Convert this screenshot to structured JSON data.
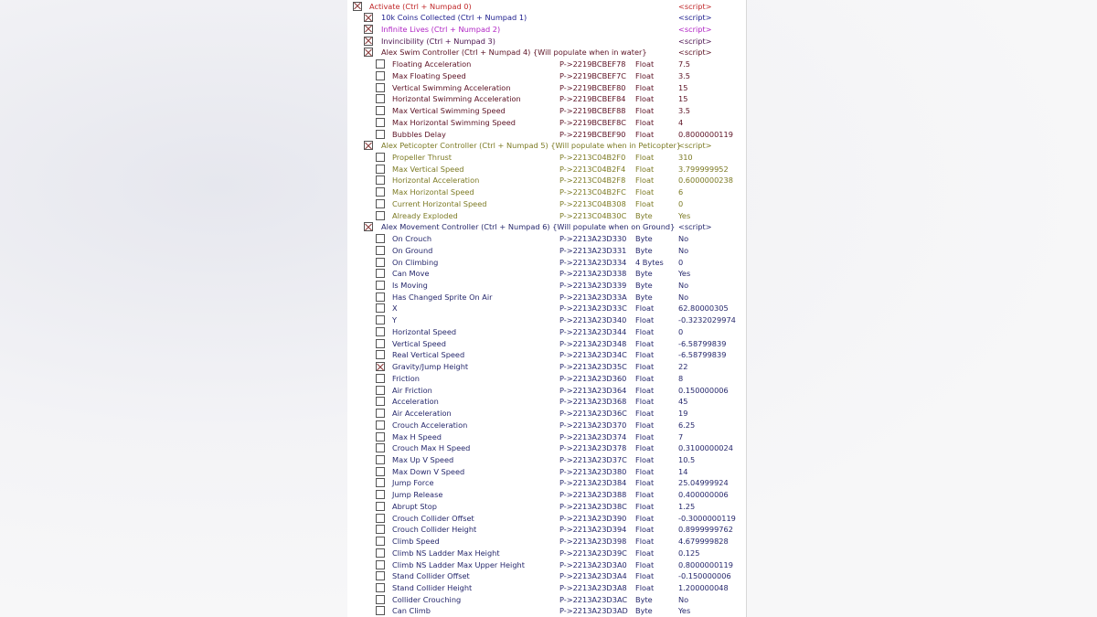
{
  "colors": {
    "activate": "#c0282a",
    "coins": "#1c1c8c",
    "lives": "#b024c4",
    "invincibility": "#4c1450",
    "swim": "#5c1224",
    "peticopter": "#7c7a24",
    "movement": "#26286c"
  },
  "rows": [
    {
      "level": 0,
      "checked": true,
      "label": "Activate (Ctrl + Numpad 0)",
      "value": "<script>",
      "color": "activate"
    },
    {
      "level": 1,
      "checked": true,
      "label": "10k Coins Collected (Ctrl + Numpad 1)",
      "value": "<script>",
      "color": "coins"
    },
    {
      "level": 1,
      "checked": true,
      "label": "Infinite Lives (Ctrl + Numpad 2)",
      "value": "<script>",
      "color": "lives"
    },
    {
      "level": 1,
      "checked": true,
      "label": "Invincibility (Ctrl + Numpad 3)",
      "value": "<script>",
      "color": "invincibility"
    },
    {
      "level": 1,
      "checked": true,
      "label": "Alex Swim Controller (Ctrl + Numpad 4) {Will populate when in water}",
      "value": "<script>",
      "color": "swim"
    },
    {
      "level": 2,
      "checked": false,
      "label": "Floating Acceleration",
      "address": "P->2219BCBEF78",
      "type": "Float",
      "value": "7.5",
      "color": "swim"
    },
    {
      "level": 2,
      "checked": false,
      "label": "Max Floating Speed",
      "address": "P->2219BCBEF7C",
      "type": "Float",
      "value": "3.5",
      "color": "swim"
    },
    {
      "level": 2,
      "checked": false,
      "label": "Vertical Swimming Acceleration",
      "address": "P->2219BCBEF80",
      "type": "Float",
      "value": "15",
      "color": "swim"
    },
    {
      "level": 2,
      "checked": false,
      "label": "Horizontal Swimming Acceleration",
      "address": "P->2219BCBEF84",
      "type": "Float",
      "value": "15",
      "color": "swim"
    },
    {
      "level": 2,
      "checked": false,
      "label": "Max Vertical Swimming Speed",
      "address": "P->2219BCBEF88",
      "type": "Float",
      "value": "3.5",
      "color": "swim"
    },
    {
      "level": 2,
      "checked": false,
      "label": "Max Horizontal Swimming Speed",
      "address": "P->2219BCBEF8C",
      "type": "Float",
      "value": "4",
      "color": "swim"
    },
    {
      "level": 2,
      "checked": false,
      "label": "Bubbles Delay",
      "address": "P->2219BCBEF90",
      "type": "Float",
      "value": "0.8000000119",
      "color": "swim"
    },
    {
      "level": 1,
      "checked": true,
      "label": "Alex Peticopter Controller (Ctrl + Numpad 5) {Will populate when in Peticopter}",
      "value": "<script>",
      "color": "peticopter"
    },
    {
      "level": 2,
      "checked": false,
      "label": "Propeller Thrust",
      "address": "P->2213C04B2F0",
      "type": "Float",
      "value": "310",
      "color": "peticopter"
    },
    {
      "level": 2,
      "checked": false,
      "label": "Max Vertical Speed",
      "address": "P->2213C04B2F4",
      "type": "Float",
      "value": "3.799999952",
      "color": "peticopter"
    },
    {
      "level": 2,
      "checked": false,
      "label": "Horizontal Acceleration",
      "address": "P->2213C04B2F8",
      "type": "Float",
      "value": "0.6000000238",
      "color": "peticopter"
    },
    {
      "level": 2,
      "checked": false,
      "label": "Max Horizontal Speed",
      "address": "P->2213C04B2FC",
      "type": "Float",
      "value": "6",
      "color": "peticopter"
    },
    {
      "level": 2,
      "checked": false,
      "label": "Current Horizontal Speed",
      "address": "P->2213C04B308",
      "type": "Float",
      "value": "0",
      "color": "peticopter"
    },
    {
      "level": 2,
      "checked": false,
      "label": "Already Exploded",
      "address": "P->2213C04B30C",
      "type": "Byte",
      "value": "Yes",
      "color": "peticopter"
    },
    {
      "level": 1,
      "checked": true,
      "label": "Alex Movement Controller (Ctrl + Numpad 6) {Will populate when on Ground}",
      "value": "<script>",
      "color": "movement"
    },
    {
      "level": 2,
      "checked": false,
      "label": "On Crouch",
      "address": "P->2213A23D330",
      "type": "Byte",
      "value": "No",
      "color": "movement"
    },
    {
      "level": 2,
      "checked": false,
      "label": "On Ground",
      "address": "P->2213A23D331",
      "type": "Byte",
      "value": "No",
      "color": "movement"
    },
    {
      "level": 2,
      "checked": false,
      "label": "On Climbing",
      "address": "P->2213A23D334",
      "type": "4 Bytes",
      "value": "0",
      "color": "movement"
    },
    {
      "level": 2,
      "checked": false,
      "label": "Can Move",
      "address": "P->2213A23D338",
      "type": "Byte",
      "value": "Yes",
      "color": "movement"
    },
    {
      "level": 2,
      "checked": false,
      "label": "Is Moving",
      "address": "P->2213A23D339",
      "type": "Byte",
      "value": "No",
      "color": "movement"
    },
    {
      "level": 2,
      "checked": false,
      "label": "Has Changed Sprite On Air",
      "address": "P->2213A23D33A",
      "type": "Byte",
      "value": "No",
      "color": "movement"
    },
    {
      "level": 2,
      "checked": false,
      "label": "X",
      "address": "P->2213A23D33C",
      "type": "Float",
      "value": "62.80000305",
      "color": "movement"
    },
    {
      "level": 2,
      "checked": false,
      "label": "Y",
      "address": "P->2213A23D340",
      "type": "Float",
      "value": "-0.3232029974",
      "color": "movement"
    },
    {
      "level": 2,
      "checked": false,
      "label": "Horizontal Speed",
      "address": "P->2213A23D344",
      "type": "Float",
      "value": "0",
      "color": "movement"
    },
    {
      "level": 2,
      "checked": false,
      "label": "Vertical Speed",
      "address": "P->2213A23D348",
      "type": "Float",
      "value": "-6.58799839",
      "color": "movement"
    },
    {
      "level": 2,
      "checked": false,
      "label": "Real Vertical Speed",
      "address": "P->2213A23D34C",
      "type": "Float",
      "value": "-6.58799839",
      "color": "movement"
    },
    {
      "level": 2,
      "checked": true,
      "label": "Gravity/Jump Height",
      "address": "P->2213A23D35C",
      "type": "Float",
      "value": "22",
      "color": "movement"
    },
    {
      "level": 2,
      "checked": false,
      "label": "Friction",
      "address": "P->2213A23D360",
      "type": "Float",
      "value": "8",
      "color": "movement"
    },
    {
      "level": 2,
      "checked": false,
      "label": "Air Friction",
      "address": "P->2213A23D364",
      "type": "Float",
      "value": "0.150000006",
      "color": "movement"
    },
    {
      "level": 2,
      "checked": false,
      "label": "Acceleration",
      "address": "P->2213A23D368",
      "type": "Float",
      "value": "45",
      "color": "movement"
    },
    {
      "level": 2,
      "checked": false,
      "label": "Air Acceleration",
      "address": "P->2213A23D36C",
      "type": "Float",
      "value": "19",
      "color": "movement"
    },
    {
      "level": 2,
      "checked": false,
      "label": "Crouch Acceleration",
      "address": "P->2213A23D370",
      "type": "Float",
      "value": "6.25",
      "color": "movement"
    },
    {
      "level": 2,
      "checked": false,
      "label": "Max H Speed",
      "address": "P->2213A23D374",
      "type": "Float",
      "value": "7",
      "color": "movement"
    },
    {
      "level": 2,
      "checked": false,
      "label": "Crouch Max H Speed",
      "address": "P->2213A23D378",
      "type": "Float",
      "value": "0.3100000024",
      "color": "movement"
    },
    {
      "level": 2,
      "checked": false,
      "label": "Max Up V Speed",
      "address": "P->2213A23D37C",
      "type": "Float",
      "value": "10.5",
      "color": "movement"
    },
    {
      "level": 2,
      "checked": false,
      "label": "Max Down V Speed",
      "address": "P->2213A23D380",
      "type": "Float",
      "value": "14",
      "color": "movement"
    },
    {
      "level": 2,
      "checked": false,
      "label": "Jump Force",
      "address": "P->2213A23D384",
      "type": "Float",
      "value": "25.04999924",
      "color": "movement"
    },
    {
      "level": 2,
      "checked": false,
      "label": "Jump Release",
      "address": "P->2213A23D388",
      "type": "Float",
      "value": "0.400000006",
      "color": "movement"
    },
    {
      "level": 2,
      "checked": false,
      "label": "Abrupt Stop",
      "address": "P->2213A23D38C",
      "type": "Float",
      "value": "1.25",
      "color": "movement"
    },
    {
      "level": 2,
      "checked": false,
      "label": "Crouch Collider Offset",
      "address": "P->2213A23D390",
      "type": "Float",
      "value": "-0.3000000119",
      "color": "movement"
    },
    {
      "level": 2,
      "checked": false,
      "label": "Crouch Collider Height",
      "address": "P->2213A23D394",
      "type": "Float",
      "value": "0.8999999762",
      "color": "movement"
    },
    {
      "level": 2,
      "checked": false,
      "label": "Climb Speed",
      "address": "P->2213A23D398",
      "type": "Float",
      "value": "4.679999828",
      "color": "movement"
    },
    {
      "level": 2,
      "checked": false,
      "label": "Climb NS Ladder Max Height",
      "address": "P->2213A23D39C",
      "type": "Float",
      "value": "0.125",
      "color": "movement"
    },
    {
      "level": 2,
      "checked": false,
      "label": "Climb NS Ladder Max Upper Height",
      "address": "P->2213A23D3A0",
      "type": "Float",
      "value": "0.8000000119",
      "color": "movement"
    },
    {
      "level": 2,
      "checked": false,
      "label": "Stand Collider Offset",
      "address": "P->2213A23D3A4",
      "type": "Float",
      "value": "-0.150000006",
      "color": "movement"
    },
    {
      "level": 2,
      "checked": false,
      "label": "Stand Collider Height",
      "address": "P->2213A23D3A8",
      "type": "Float",
      "value": "1.200000048",
      "color": "movement"
    },
    {
      "level": 2,
      "checked": false,
      "label": "Collider Crouching",
      "address": "P->2213A23D3AC",
      "type": "Byte",
      "value": "No",
      "color": "movement"
    },
    {
      "level": 2,
      "checked": false,
      "label": "Can Climb",
      "address": "P->2213A23D3AD",
      "type": "Byte",
      "value": "Yes",
      "color": "movement"
    }
  ]
}
